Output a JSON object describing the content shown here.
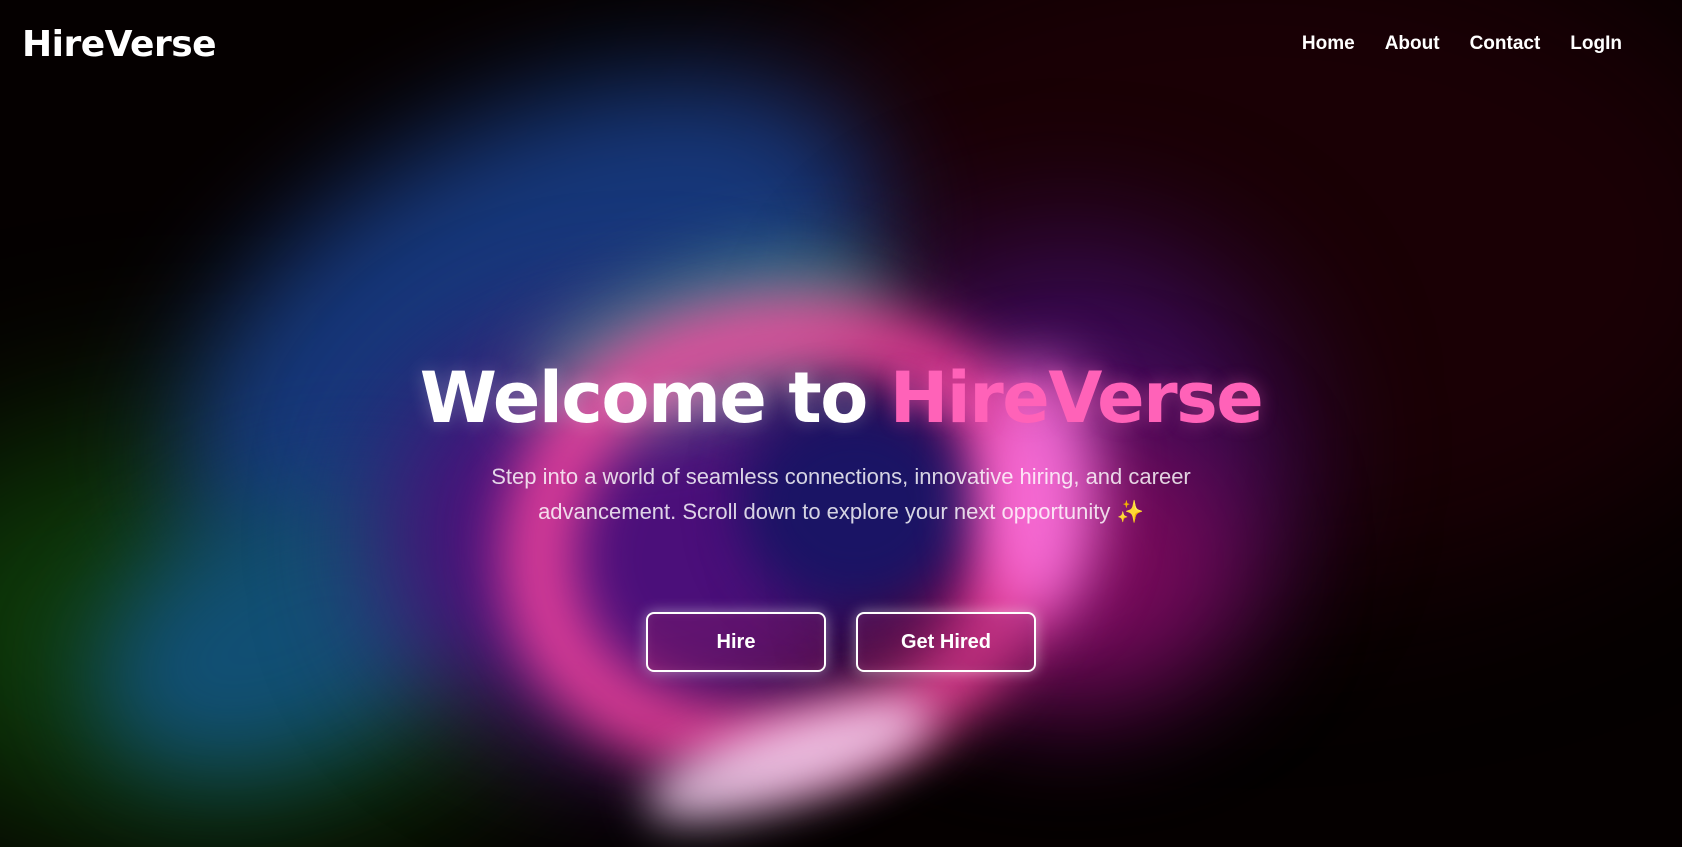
{
  "brand": {
    "name": "HireVerse"
  },
  "nav": {
    "items": [
      {
        "label": "Home"
      },
      {
        "label": "About"
      },
      {
        "label": "Contact"
      },
      {
        "label": "LogIn"
      }
    ]
  },
  "hero": {
    "title_prefix": "Welcome to ",
    "title_accent": "HireVerse",
    "subtitle": "Step into a world of seamless connections, innovative hiring, and career advancement. Scroll down to explore your next opportunity",
    "sparkle": "✨"
  },
  "buttons": {
    "hire_label": "Hire",
    "get_hired_label": "Get Hired"
  },
  "colors": {
    "accent": "#ff62b8",
    "background": "#000000",
    "text": "#ffffff"
  }
}
